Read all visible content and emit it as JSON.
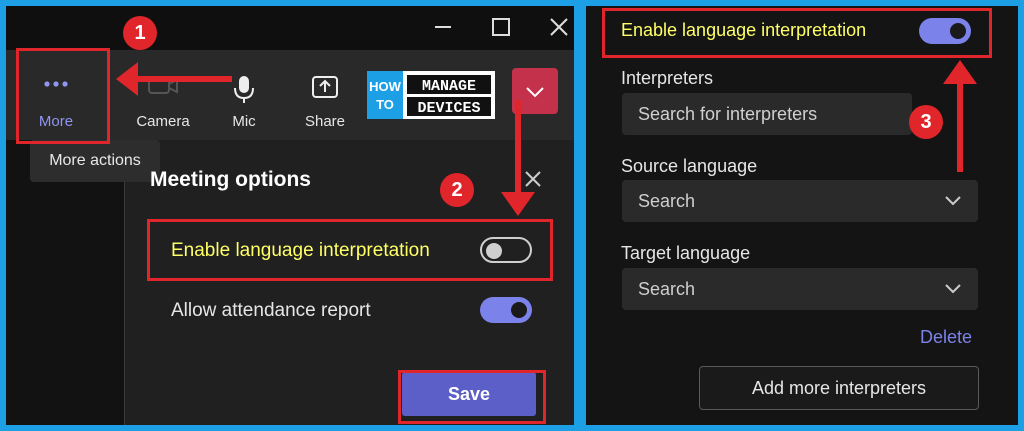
{
  "toolbar": {
    "more_label": "More",
    "camera_label": "Camera",
    "mic_label": "Mic",
    "share_label": "Share",
    "tooltip": "More actions"
  },
  "logo": {
    "line1": "HOW",
    "line2": "TO",
    "word1": "MANAGE",
    "word2": "DEVICES"
  },
  "meeting_options": {
    "title": "Meeting options",
    "language_interpretation_label": "Enable language interpretation",
    "language_interpretation_on": false,
    "attendance_label": "Allow attendance report",
    "attendance_on": true,
    "save_label": "Save"
  },
  "interpretation_panel": {
    "enable_label": "Enable language interpretation",
    "enable_on": true,
    "interpreters_label": "Interpreters",
    "interpreters_placeholder": "Search for interpreters",
    "source_label": "Source language",
    "source_value": "Search",
    "target_label": "Target language",
    "target_value": "Search",
    "delete_label": "Delete",
    "add_more_label": "Add more interpreters"
  },
  "annotations": {
    "step1": "1",
    "step2": "2",
    "step3": "3"
  },
  "colors": {
    "accent": "#7b83eb",
    "highlight": "#e0252b",
    "yellow_text": "#ffff66",
    "frame": "#1d9fe6"
  }
}
